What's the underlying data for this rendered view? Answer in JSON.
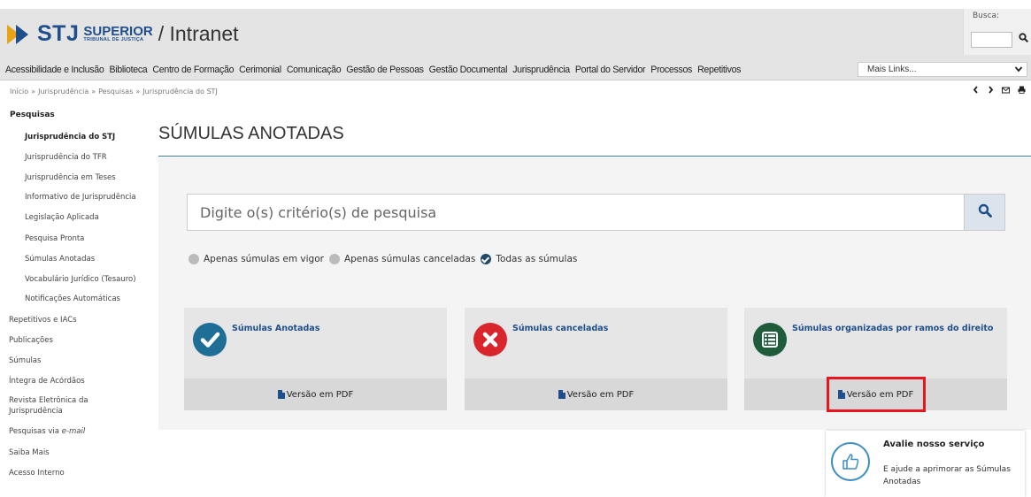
{
  "header": {
    "logo_stj": "STJ",
    "logo_superior": "SUPERIOR",
    "logo_tribunal": "TRIBUNAL DE JUSTIÇA",
    "logo_intranet": "/ Intranet",
    "busca_label": "Busca:",
    "busca_value": ""
  },
  "nav": {
    "items": [
      "Acessibilidade e Inclusão",
      "Biblioteca",
      "Centro de Formação",
      "Cerimonial",
      "Comunicação",
      "Gestão de Pessoas",
      "Gestão Documental",
      "Jurisprudência",
      "Portal do Servidor",
      "Processos",
      "Repetitivos"
    ],
    "mais_links": "Mais Links..."
  },
  "breadcrumb": [
    "Início",
    "Jurisprudência",
    "Pesquisas",
    "Jurisprudência do STJ"
  ],
  "breadcrumb_sep": "»",
  "sidebar": {
    "heading": "Pesquisas",
    "sub_items": [
      "Jurisprudência do STJ",
      "Jurisprudência do TFR",
      "Jurisprudência em Teses",
      "Informativo de Jurisprudência",
      "Legislação Aplicada",
      "Pesquisa Pronta",
      "Súmulas Anotadas",
      "Vocabulário Jurídico (Tesauro)",
      "Notificações Automáticas"
    ],
    "top_items": [
      "Repetitivos e IACs",
      "Publicações",
      "Súmulas",
      "Íntegra de Acórdãos",
      "Revista Eletrônica da",
      "Jurisprudência",
      "Pesquisas via ",
      "e-mail",
      "Saiba Mais",
      "Acesso Interno"
    ]
  },
  "main": {
    "title": "SÚMULAS ANOTADAS",
    "search_placeholder": "Digite o(s) critério(s) de pesquisa",
    "search_value": "",
    "radios": [
      {
        "label": "Apenas súmulas em vigor",
        "checked": false
      },
      {
        "label": "Apenas súmulas canceladas",
        "checked": false
      },
      {
        "label": "Todas as súmulas",
        "checked": true
      }
    ],
    "cards": [
      {
        "title": "Súmulas Anotadas",
        "link": "Versão em PDF",
        "icon": "check-icon",
        "color": "#1f6e96"
      },
      {
        "title": "Súmulas canceladas",
        "link": "Versão em PDF",
        "icon": "x-icon",
        "color": "#d9252c"
      },
      {
        "title": "Súmulas organizadas por ramos do direito",
        "link": "Versão em PDF",
        "icon": "list-icon",
        "color": "#1e5c3c"
      }
    ]
  },
  "feedback": {
    "title": "Avalie nosso serviço",
    "text": "E ajude a aprimorar as Súmulas Anotadas",
    "icon": "thumbs-up-icon"
  }
}
